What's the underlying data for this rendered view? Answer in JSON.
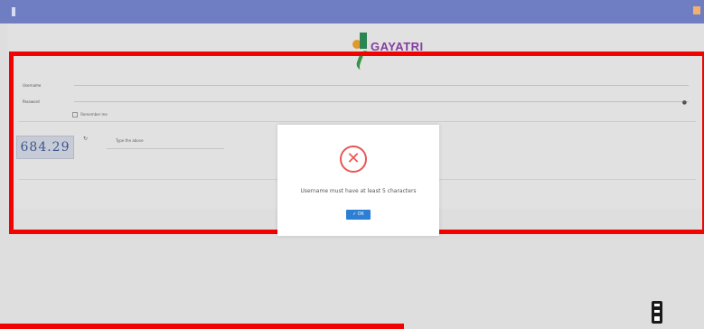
{
  "app": {
    "brand_name": "GAYATRI"
  },
  "login": {
    "username_label": "Username",
    "password_label": "Password",
    "remember_label": "Remember me",
    "captcha_text": "684.29",
    "captcha_placeholder": "Type the above"
  },
  "dialog": {
    "message": "Username must have at least 5 characters",
    "ok_label": "✓ OK"
  },
  "colors": {
    "topbar": "#6f7dc2",
    "error": "#e85656",
    "ok_button": "#2d7fd3",
    "annotation_red": "#f00300",
    "brand": "#8b3fa8"
  }
}
